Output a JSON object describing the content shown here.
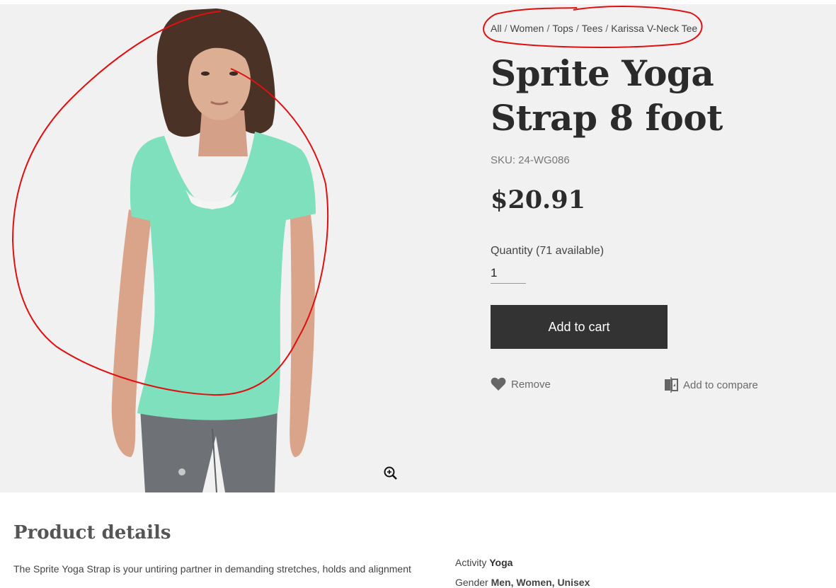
{
  "breadcrumb": {
    "items": [
      "All",
      "Women",
      "Tops",
      "Tees",
      "Karissa V-Neck Tee"
    ],
    "separator": "/"
  },
  "product": {
    "title": "Sprite Yoga Strap 8 foot",
    "sku": "SKU: 24-WG086",
    "price": "$20.91",
    "quantity_label": "Quantity (71 available)",
    "quantity_value": "1",
    "add_to_cart_label": "Add to cart",
    "remove_label": "Remove",
    "compare_label": "Add to compare"
  },
  "gallery": {
    "image_description": "Woman wearing mint green V-neck tee and grey leggings",
    "zoom_icon": "zoom-in-icon"
  },
  "details": {
    "heading": "Product details",
    "description": "The Sprite Yoga Strap is your untiring partner in demanding stretches, holds and alignment",
    "attributes": [
      {
        "label": "Activity",
        "value": "Yoga"
      },
      {
        "label": "Gender",
        "value": "Men, Women, Unisex"
      }
    ]
  },
  "colors": {
    "hero_background": "#f1f1f1",
    "button": "#333333",
    "annotation": "#e01010",
    "tee": "#7ee0bd"
  }
}
